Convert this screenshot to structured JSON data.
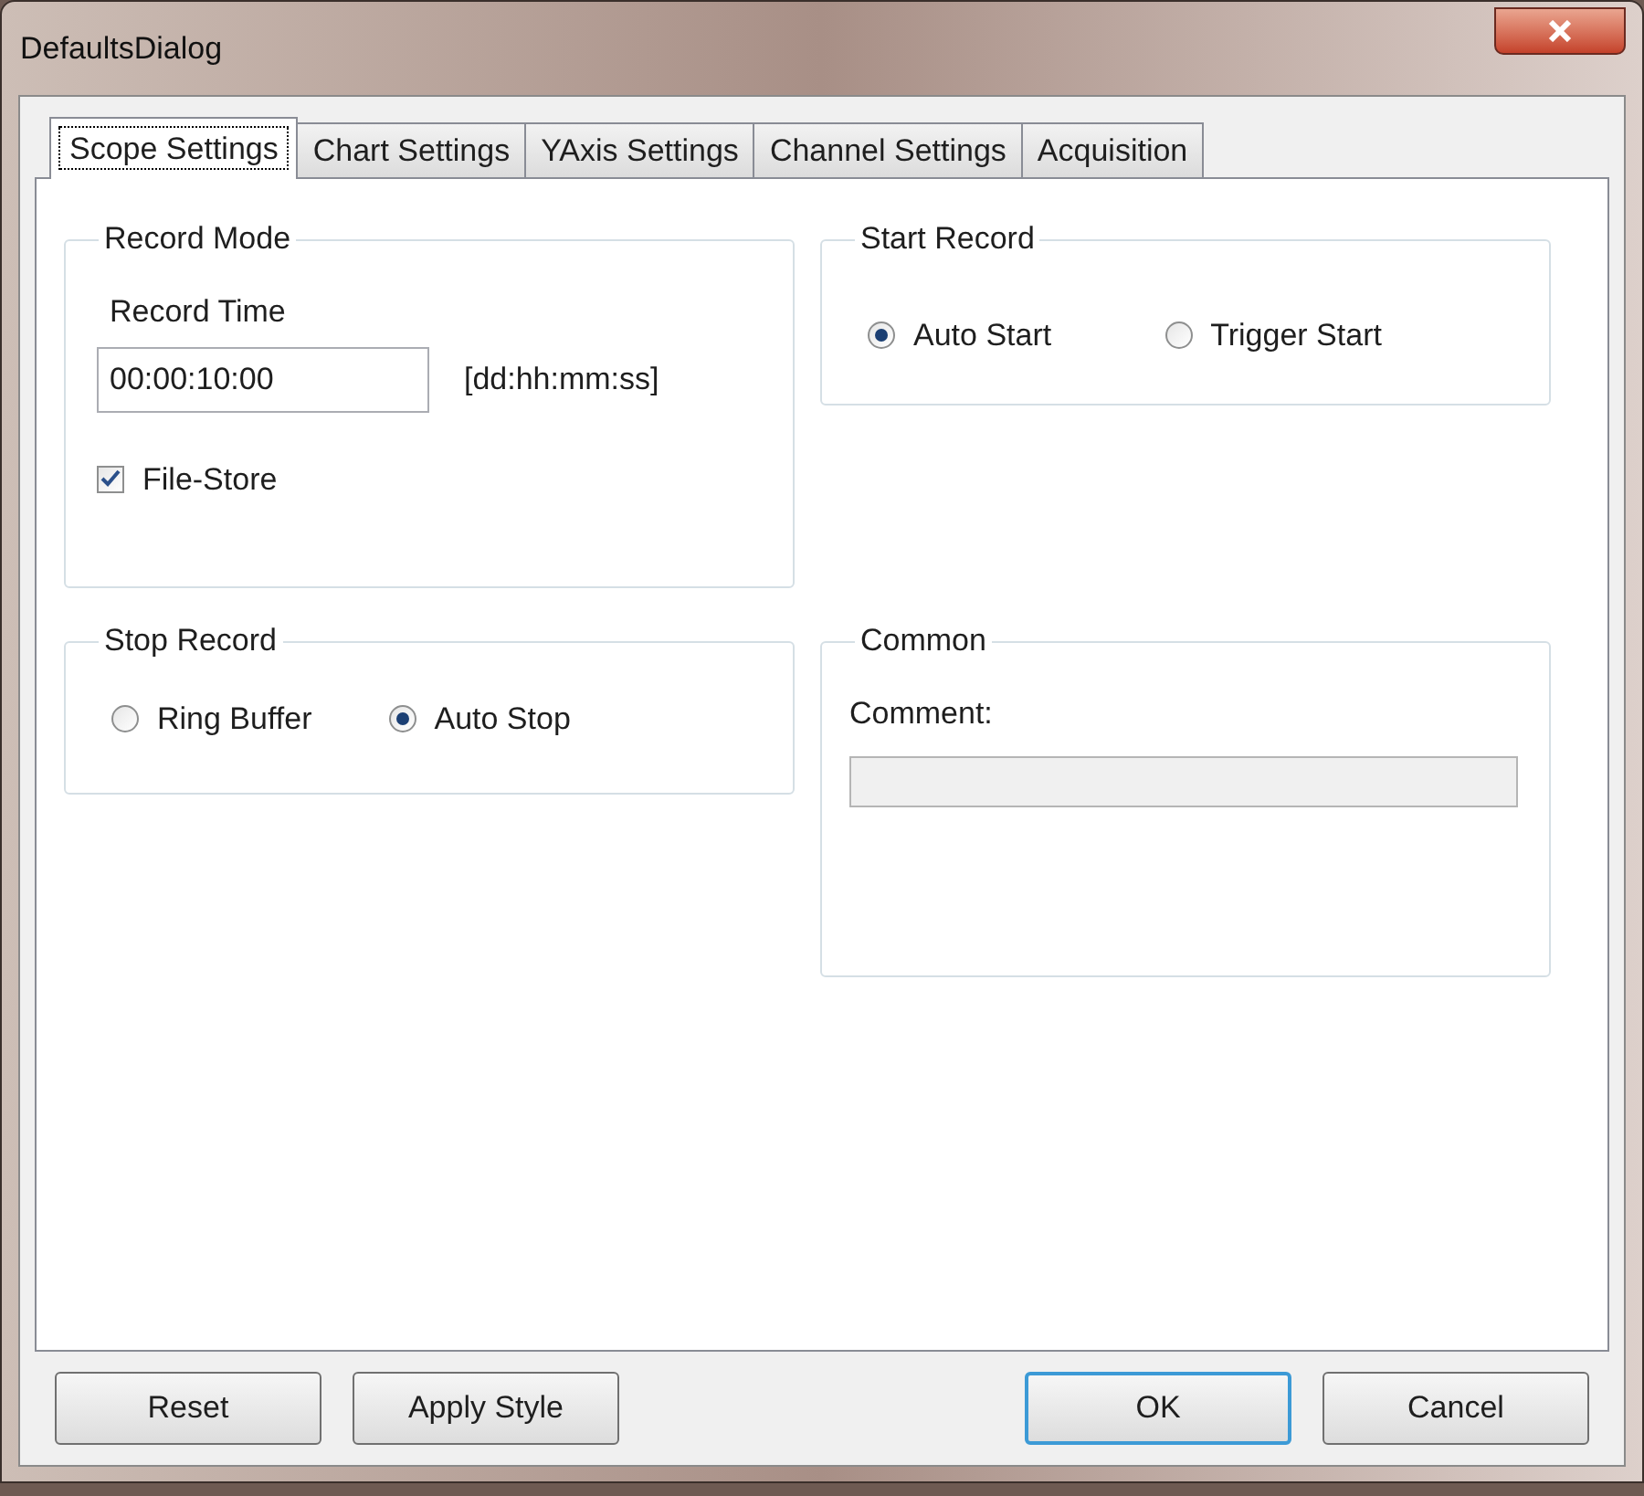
{
  "window": {
    "title": "DefaultsDialog"
  },
  "tabs": [
    {
      "label": "Scope Settings",
      "selected": true
    },
    {
      "label": "Chart Settings",
      "selected": false
    },
    {
      "label": "YAxis Settings",
      "selected": false
    },
    {
      "label": "Channel Settings",
      "selected": false
    },
    {
      "label": "Acquisition",
      "selected": false
    }
  ],
  "record_mode": {
    "title": "Record Mode",
    "record_time_label": "Record Time",
    "record_time": "00:00:10:00",
    "format_hint": "[dd:hh:mm:ss]",
    "file_store": {
      "label": "File-Store",
      "checked": true
    }
  },
  "start_record": {
    "title": "Start Record",
    "options": [
      {
        "label": "Auto Start",
        "selected": true
      },
      {
        "label": "Trigger Start",
        "selected": false
      }
    ]
  },
  "stop_record": {
    "title": "Stop Record",
    "options": [
      {
        "label": "Ring Buffer",
        "selected": false
      },
      {
        "label": "Auto Stop",
        "selected": true
      }
    ]
  },
  "common": {
    "title": "Common",
    "comment_label": "Comment:",
    "comment_disabled": true
  },
  "buttons": [
    {
      "label": "Reset",
      "default": false
    },
    {
      "label": "Apply Style",
      "default": false
    },
    {
      "label": "OK",
      "default": true
    },
    {
      "label": "Cancel",
      "default": false
    }
  ]
}
